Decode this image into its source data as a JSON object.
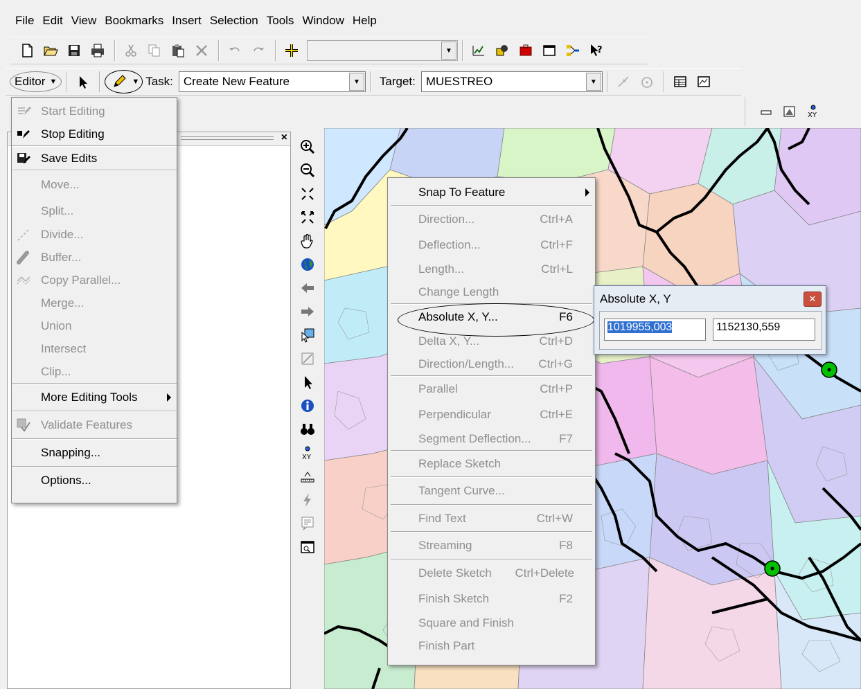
{
  "menubar": [
    "File",
    "Edit",
    "View",
    "Bookmarks",
    "Insert",
    "Selection",
    "Tools",
    "Window",
    "Help"
  ],
  "editor_toolbar": {
    "editor_label": "Editor",
    "task_label": "Task:",
    "task_value": "Create New Feature",
    "target_label": "Target:",
    "target_value": "MUESTREO"
  },
  "editor_menu": [
    {
      "label": "Start Editing",
      "disabled": true,
      "icon": "start-editing-icon"
    },
    {
      "label": "Stop Editing",
      "disabled": false,
      "icon": "stop-editing-icon"
    },
    {
      "label": "Save Edits",
      "disabled": false,
      "icon": "save-edits-icon"
    },
    {
      "label": "Move...",
      "disabled": true
    },
    {
      "label": "Split...",
      "disabled": true
    },
    {
      "label": "Divide...",
      "disabled": true,
      "icon": "divide-icon"
    },
    {
      "label": "Buffer...",
      "disabled": true,
      "icon": "buffer-icon"
    },
    {
      "label": "Copy Parallel...",
      "disabled": true,
      "icon": "copy-parallel-icon"
    },
    {
      "label": "Merge...",
      "disabled": true
    },
    {
      "label": "Union",
      "disabled": true
    },
    {
      "label": "Intersect",
      "disabled": true
    },
    {
      "label": "Clip...",
      "disabled": true
    },
    {
      "label": "More Editing Tools",
      "disabled": false,
      "submenu": true
    },
    {
      "label": "Validate Features",
      "disabled": true,
      "icon": "validate-features-icon"
    },
    {
      "label": "Snapping...",
      "disabled": false
    },
    {
      "label": "Options...",
      "disabled": false
    }
  ],
  "context_menu": [
    {
      "label": "Snap To Feature",
      "shortcut": "",
      "disabled": false,
      "submenu": true
    },
    {
      "label": "Direction...",
      "shortcut": "Ctrl+A",
      "disabled": true
    },
    {
      "label": "Deflection...",
      "shortcut": "Ctrl+F",
      "disabled": true
    },
    {
      "label": "Length...",
      "shortcut": "Ctrl+L",
      "disabled": true
    },
    {
      "label": "Change Length",
      "shortcut": "",
      "disabled": true
    },
    {
      "label": "Absolute X, Y...",
      "shortcut": "F6",
      "disabled": false
    },
    {
      "label": "Delta X, Y...",
      "shortcut": "Ctrl+D",
      "disabled": true
    },
    {
      "label": "Direction/Length...",
      "shortcut": "Ctrl+G",
      "disabled": true
    },
    {
      "label": "Parallel",
      "shortcut": "Ctrl+P",
      "disabled": true
    },
    {
      "label": "Perpendicular",
      "shortcut": "Ctrl+E",
      "disabled": true
    },
    {
      "label": "Segment Deflection...",
      "shortcut": "F7",
      "disabled": true
    },
    {
      "label": "Replace Sketch",
      "shortcut": "",
      "disabled": true
    },
    {
      "label": "Tangent Curve...",
      "shortcut": "",
      "disabled": true
    },
    {
      "label": "Find Text",
      "shortcut": "Ctrl+W",
      "disabled": true
    },
    {
      "label": "Streaming",
      "shortcut": "F8",
      "disabled": true
    },
    {
      "label": "Delete Sketch",
      "shortcut": "Ctrl+Delete",
      "disabled": true
    },
    {
      "label": "Finish Sketch",
      "shortcut": "F2",
      "disabled": true
    },
    {
      "label": "Square and Finish",
      "shortcut": "",
      "disabled": true
    },
    {
      "label": "Finish Part",
      "shortcut": "",
      "disabled": true
    }
  ],
  "absolute_xy": {
    "title": "Absolute X, Y",
    "x_value": "1019955,003",
    "y_value": "1152130,559"
  },
  "colors": {
    "menu_bg": "#f0f0f0",
    "disabled_text": "#8f8f8f",
    "selection": "#3070d0",
    "close_button": "#c9503e",
    "map_point": "#00c000"
  }
}
